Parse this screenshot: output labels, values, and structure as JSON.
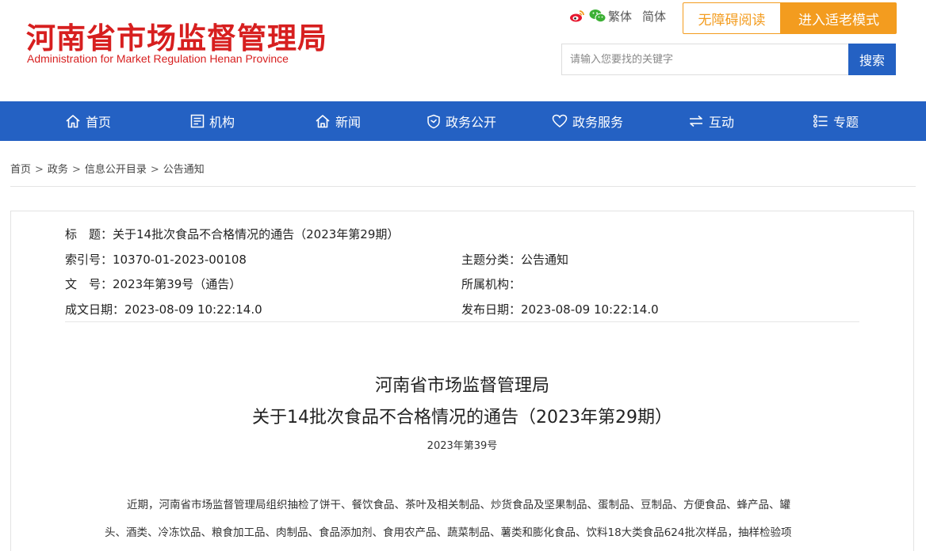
{
  "header": {
    "title": "河南省市场监督管理局",
    "subtitle": "Administration for Market Regulation Henan Province",
    "lang_traditional": "繁体",
    "lang_simplified": "简体",
    "accessibility_label": "无障碍阅读",
    "elder_mode_label": "进入适老模式",
    "search_placeholder": "请输入您要找的关键字",
    "search_button": "搜索",
    "icons": [
      "weibo-icon",
      "wechat-icon"
    ]
  },
  "colors": {
    "brand_red": "#d71f1f",
    "nav_blue": "#2461c3",
    "accent_orange": "#f39c1f"
  },
  "nav": {
    "items": [
      {
        "label": "首页",
        "icon": "home-icon"
      },
      {
        "label": "机构",
        "icon": "org-icon"
      },
      {
        "label": "新闻",
        "icon": "news-icon"
      },
      {
        "label": "政务公开",
        "icon": "shield-icon"
      },
      {
        "label": "政务服务",
        "icon": "heart-icon"
      },
      {
        "label": "互动",
        "icon": "exchange-icon"
      },
      {
        "label": "专题",
        "icon": "topic-icon"
      }
    ]
  },
  "breadcrumb": {
    "items": [
      "首页",
      "政务",
      "信息公开目录",
      "公告通知"
    ],
    "separator": ">"
  },
  "meta": {
    "title_label": "标　题：",
    "title_value": "关于14批次食品不合格情况的通告（2023年第29期）",
    "index_label": "索引号：",
    "index_value": "10370-01-2023-00108",
    "category_label": "主题分类：",
    "category_value": "公告通知",
    "docno_label": "文　号：",
    "docno_value": "2023年第39号（通告）",
    "org_label": "所属机构：",
    "org_value": "",
    "created_label": "成文日期：",
    "created_value": "2023-08-09 10:22:14.0",
    "published_label": "发布日期：",
    "published_value": "2023-08-09 10:22:14.0"
  },
  "document": {
    "org": "河南省市场监督管理局",
    "title": "关于14批次食品不合格情况的通告（2023年第29期）",
    "number": "2023年第39号",
    "paragraph_line1": "近期，河南省市场监督管理局组织抽检了饼干、餐饮食品、茶叶及相关制品、炒货食品及坚果制品、蛋制品、豆制品、方便食品、蜂产品、罐",
    "paragraph_line2": "头、酒类、冷冻饮品、粮食加工品、肉制品、食品添加剂、食用农产品、蔬菜制品、薯类和膨化食品、饮料18大类食品624批次样品，抽样检验项"
  }
}
